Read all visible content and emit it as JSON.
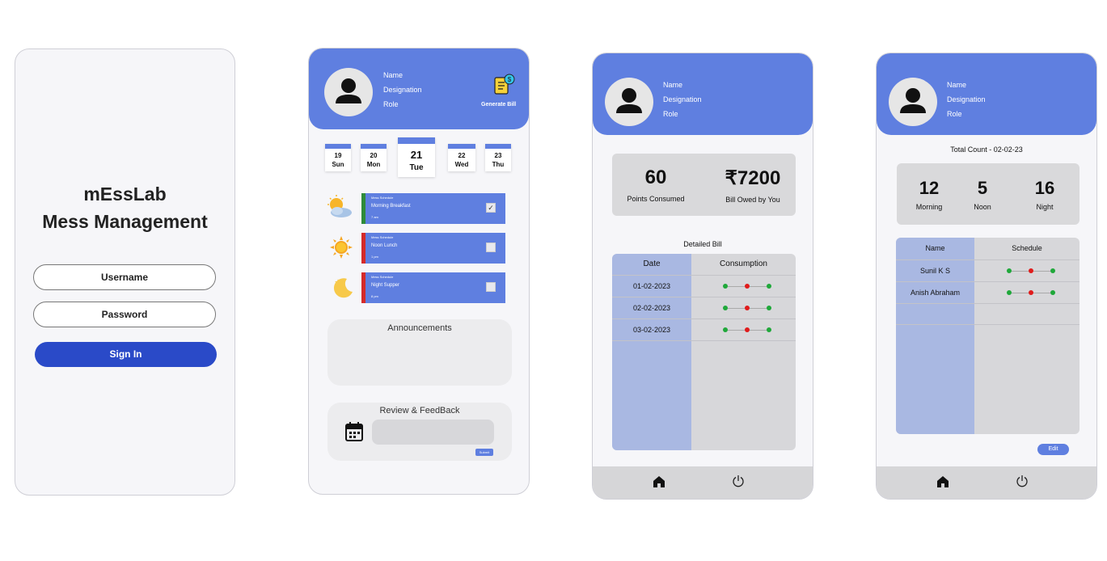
{
  "login": {
    "app_name": "mEssLab",
    "subtitle": "Mess Management",
    "username_placeholder": "Username",
    "password_placeholder": "Password",
    "signin_label": "Sign In"
  },
  "profile": {
    "name": "Name",
    "designation": "Designation",
    "role": "Role"
  },
  "dashboard": {
    "generate_bill_label": "Generate Bill",
    "days": [
      {
        "num": "19",
        "day": "Sun"
      },
      {
        "num": "20",
        "day": "Mon"
      },
      {
        "num": "21",
        "day": "Tue"
      },
      {
        "num": "22",
        "day": "Wed"
      },
      {
        "num": "23",
        "day": "Thu"
      }
    ],
    "meals": [
      {
        "caption": "Mess Schedule",
        "name": "Morning Breakfast",
        "time": "7 am",
        "checked": true,
        "bar_color": "#2e8b3a"
      },
      {
        "caption": "Mess Schedule",
        "name": "Noon Lunch",
        "time": "1 pm",
        "checked": false,
        "bar_color": "#d42a2a"
      },
      {
        "caption": "Mess Schedule",
        "name": "Night Supper",
        "time": "8 pm",
        "checked": false,
        "bar_color": "#d42a2a"
      }
    ],
    "announcements_title": "Announcements",
    "review_title": "Review & FeedBack",
    "submit_label": "Submit"
  },
  "bill": {
    "points": "60",
    "points_label": "Points Consumed",
    "amount": "₹7200",
    "amount_label": "Bill Owed by You",
    "detailed_title": "Detailed Bill",
    "col_date": "Date",
    "col_consumption": "Consumption",
    "rows": [
      {
        "date": "01-02-2023",
        "meals": [
          "green",
          "red",
          "green"
        ]
      },
      {
        "date": "02-02-2023",
        "meals": [
          "green",
          "red",
          "green"
        ]
      },
      {
        "date": "03-02-2023",
        "meals": [
          "green",
          "red",
          "green"
        ]
      }
    ]
  },
  "admin": {
    "total_count": "Total Count - 02-02-23",
    "morning": "12",
    "morning_label": "Morning",
    "noon": "5",
    "noon_label": "Noon",
    "night": "16",
    "night_label": "Night",
    "col_name": "Name",
    "col_schedule": "Schedule",
    "rows": [
      {
        "name": "Sunil K S",
        "meals": [
          "green",
          "red",
          "green"
        ]
      },
      {
        "name": "Anish Abraham",
        "meals": [
          "green",
          "red",
          "green"
        ]
      }
    ],
    "edit_label": "Edit"
  },
  "colors": {
    "accent": "#5f7fe0",
    "signin": "#2a4ac8",
    "green": "#1fa83a",
    "red": "#e01b1b"
  },
  "icons": [
    "avatar-icon",
    "bill-scroll-icon",
    "sun-cloud-icon",
    "sun-icon",
    "moon-star-icon",
    "calendar-icon",
    "home-icon",
    "power-icon",
    "checkbox-icon"
  ]
}
